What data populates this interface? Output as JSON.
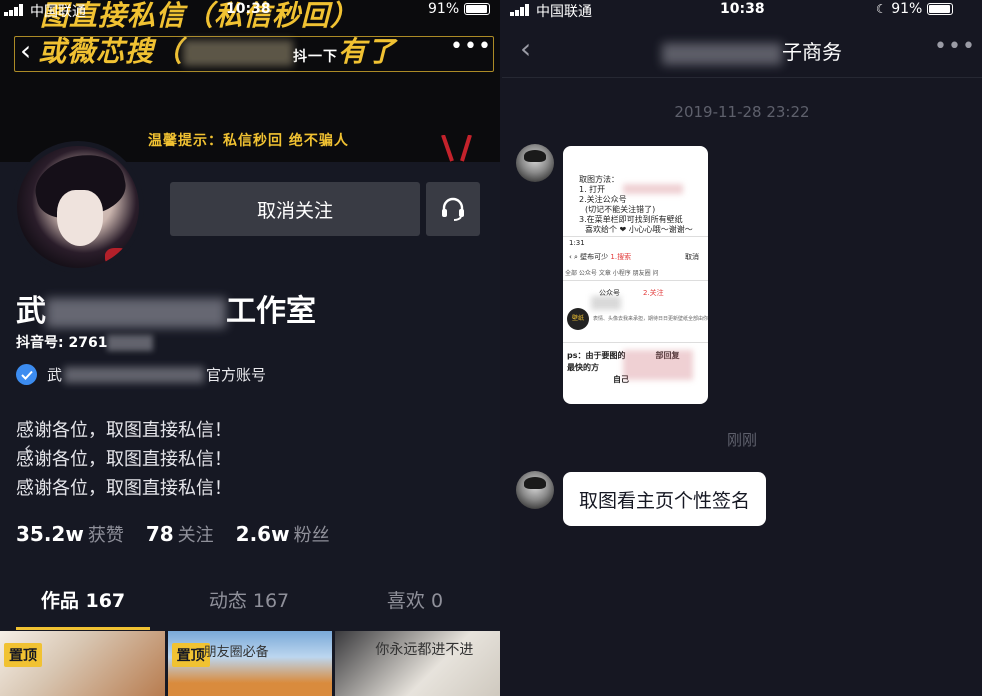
{
  "left_status": {
    "carrier": "中国联通",
    "time": "10:38",
    "battery": "91%"
  },
  "banner": {
    "line1": "图直接私信（私信秒回）",
    "line2_a": "或薇芯搜（",
    "line2_b": "抖一下",
    "line2_c": "有了",
    "tip": "温馨提示：私信秒回 绝不骗人"
  },
  "profile": {
    "unfollow_label": "取消关注",
    "name_first": "武",
    "name_suffix": "工作室",
    "douyin_id_label": "抖音号: 2761",
    "verify_prefix": "武",
    "verify_suffix": "官方账号",
    "bio_lines": [
      "感谢各位，取图直接私信！",
      "感谢各位，取图直接私信！",
      "感谢各位，取图直接私信！"
    ],
    "stats": [
      {
        "value": "35.2w",
        "label": "获赞"
      },
      {
        "value": "78",
        "label": "关注"
      },
      {
        "value": "2.6w",
        "label": "粉丝"
      }
    ],
    "tabs": [
      {
        "label": "作品 167"
      },
      {
        "label": "动态 167"
      },
      {
        "label": "喜欢 0"
      }
    ],
    "grid": [
      {
        "pin": "置顶",
        "text": ""
      },
      {
        "pin": "置顶",
        "text": "朋友圈必备"
      },
      {
        "pin": "",
        "text": "你永远都进不进"
      }
    ]
  },
  "right_status": {
    "carrier": "中国联通",
    "time": "10:38",
    "battery": "91%"
  },
  "chat": {
    "title_suffix": "子商务",
    "timestamp_1": "2019-11-28 23:22",
    "timestamp_2": "刚刚",
    "image_lines": {
      "l1": "取图方法：",
      "l2": "1. 打开",
      "l3": "2.关注公众号",
      "l4": "(切记不能关注错了)",
      "l5": "3.在菜单栏即可找到所有壁纸",
      "l6": "喜欢给个 ❤ 小心心哦～谢谢～",
      "phone_time": "1:31",
      "search_text": "壁布可少",
      "step1": "1.搜索",
      "cancel": "取消",
      "tabs": "全部  公众号  文章  小程序  朋友圈  问",
      "gzh": "公众号",
      "step2": "2.关注",
      "desc": "表情、头像去我来承担，期待日日更新壁纸全部由你来",
      "logo": "壁纸",
      "ps1": "ps：由于要图的",
      "ps2": "部回复",
      "ps3": "最快的方",
      "ps4": "自己"
    },
    "text_message": "取图看主页个性签名"
  }
}
